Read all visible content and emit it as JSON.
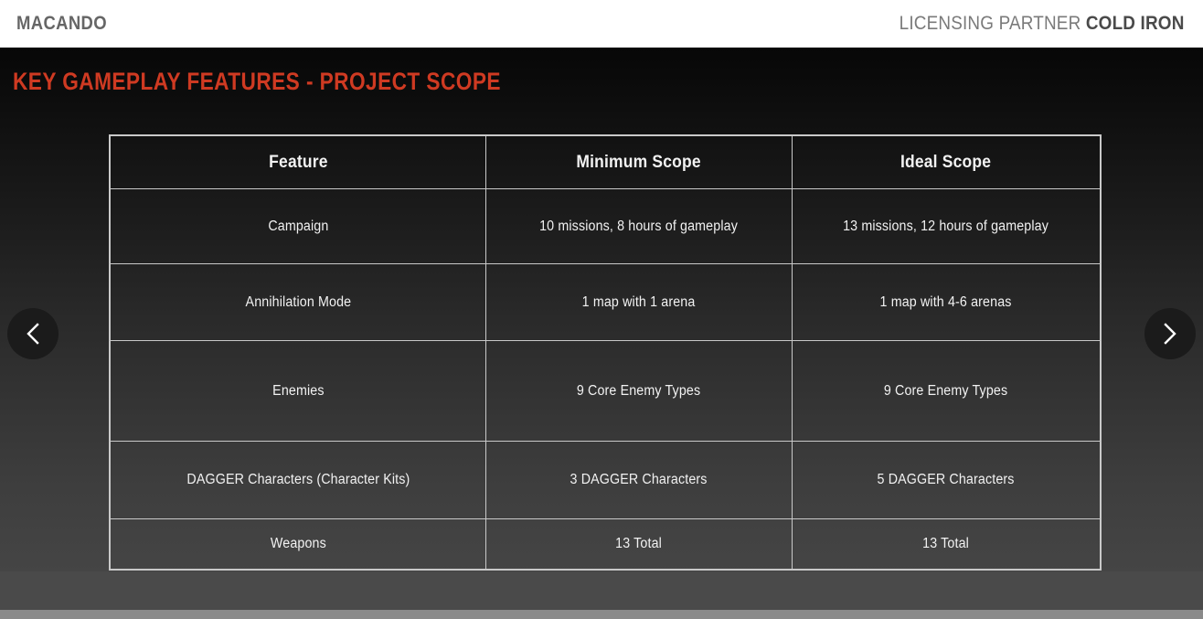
{
  "header": {
    "brand": "MACANDO",
    "partner_prefix": "LICENSING PARTNER",
    "partner_name": "COLD IRON"
  },
  "slide": {
    "title": "KEY GAMEPLAY FEATURES - PROJECT SCOPE",
    "accent_color": "#cf3a22",
    "background_top": "#070707",
    "background_bottom": "#454545"
  },
  "carousel": {
    "prev_label": "Previous slide",
    "next_label": "Next slide",
    "prev_icon": "chevron-left-icon",
    "next_icon": "chevron-right-icon"
  },
  "table": {
    "columns": [
      "Feature",
      "Minimum Scope",
      "Ideal Scope"
    ],
    "rows": [
      {
        "feature": "Campaign",
        "minimum": "10 missions, 8 hours of gameplay",
        "ideal": "13 missions, 12 hours of gameplay"
      },
      {
        "feature": "Annihilation Mode",
        "minimum": "1 map with 1 arena",
        "ideal": "1 map with 4-6 arenas"
      },
      {
        "feature": "Enemies",
        "minimum": "9 Core Enemy Types",
        "ideal": "9 Core Enemy Types"
      },
      {
        "feature": "DAGGER Characters (Character Kits)",
        "minimum": "3 DAGGER Characters",
        "ideal": "5 DAGGER Characters"
      },
      {
        "feature": "Weapons",
        "minimum": "13 Total",
        "ideal": "13 Total"
      }
    ]
  }
}
